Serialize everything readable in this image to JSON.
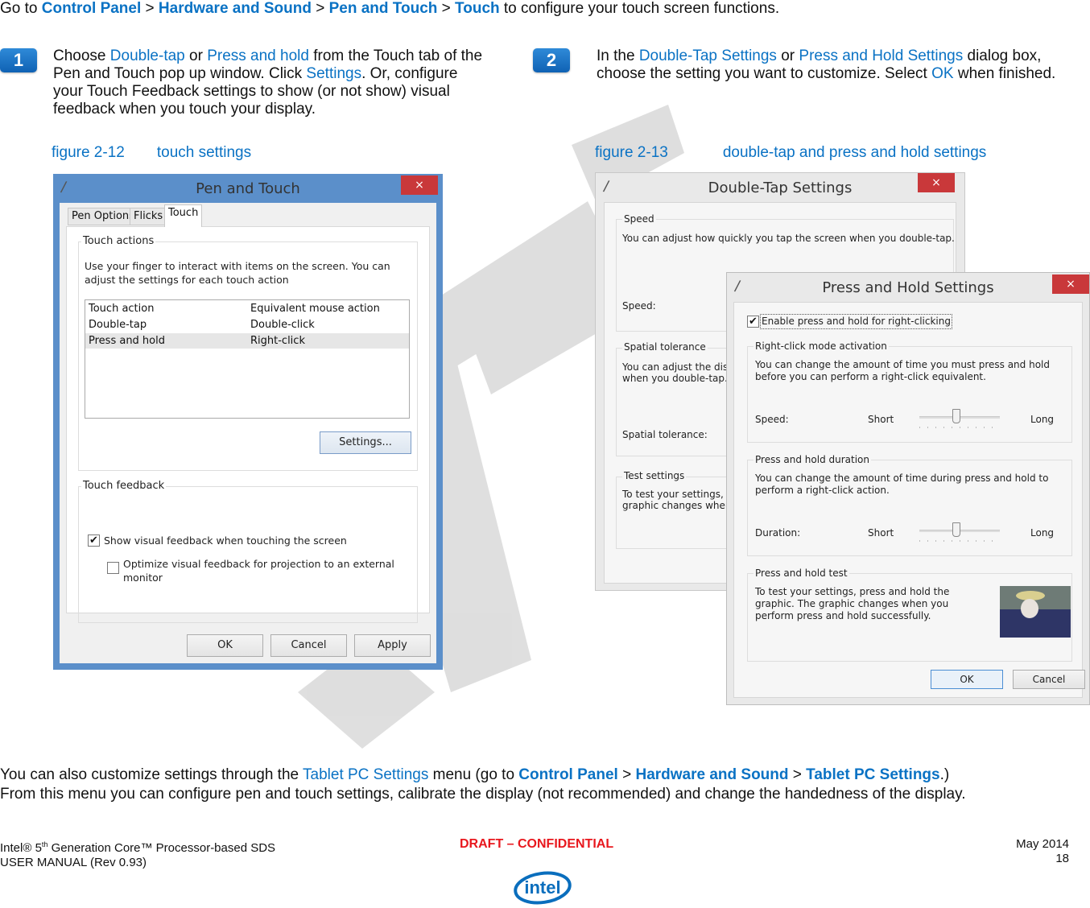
{
  "breadcrumb": {
    "prefix": "Go to ",
    "items": [
      "Control Panel",
      "Hardware and Sound",
      "Pen and Touch",
      "Touch"
    ],
    "separator": " > ",
    "suffix": " to configure your touch screen functions."
  },
  "steps": [
    {
      "number": "1",
      "text_parts": [
        {
          "t": "Choose ",
          "link": false
        },
        {
          "t": "Double-tap",
          "link": true
        },
        {
          "t": " or ",
          "link": false
        },
        {
          "t": "Press and hold",
          "link": true
        },
        {
          "t": " from the Touch tab of the Pen and Touch pop up window. Click ",
          "link": false
        },
        {
          "t": "Settings",
          "link": true
        },
        {
          "t": ". Or, configure your Touch Feedback settings to show (or not show) visual feedback when you touch your display.",
          "link": false
        }
      ],
      "figure_number": "figure 2-12",
      "figure_caption": "touch settings"
    },
    {
      "number": "2",
      "text_parts": [
        {
          "t": "In the ",
          "link": false
        },
        {
          "t": "Double-Tap Settings",
          "link": true
        },
        {
          "t": " or ",
          "link": false
        },
        {
          "t": "Press and Hold Settings",
          "link": true
        },
        {
          "t": " dialog box, choose the setting you want to customize. Select ",
          "link": false
        },
        {
          "t": "OK",
          "link": true
        },
        {
          "t": " when finished.",
          "link": false
        }
      ],
      "figure_number": "figure 2-13",
      "figure_caption": "double-tap and press and hold settings"
    }
  ],
  "pen_touch_dialog": {
    "title": "Pen and Touch",
    "close": "×",
    "tabs": [
      "Pen Options",
      "Flicks",
      "Touch"
    ],
    "active_tab": "Touch",
    "touch_actions_label": "Touch actions",
    "touch_actions_desc": "Use your finger to interact with items on the screen. You can adjust the settings for each touch action",
    "columns": [
      "Touch action",
      "Equivalent mouse action"
    ],
    "rows": [
      {
        "action": "Double-tap",
        "mouse": "Double-click",
        "selected": false
      },
      {
        "action": "Press and hold",
        "mouse": "Right-click",
        "selected": true
      }
    ],
    "settings_button": "Settings...",
    "touch_feedback_label": "Touch feedback",
    "show_feedback": {
      "label": "Show visual feedback when touching the screen",
      "checked": true
    },
    "optimize_feedback": {
      "label": "Optimize visual feedback for projection to an external monitor",
      "checked": false
    },
    "buttons": {
      "ok": "OK",
      "cancel": "Cancel",
      "apply": "Apply"
    }
  },
  "double_tap_dialog": {
    "title": "Double-Tap Settings",
    "close": "×",
    "speed_label": "Speed",
    "speed_desc": "You can adjust how quickly you tap the screen when you double-tap.",
    "speed_field": "Speed:",
    "spatial_label": "Spatial tolerance",
    "spatial_desc_1": "You can adjust the dista",
    "spatial_desc_2": "when you double-tap.",
    "spatial_field": "Spatial tolerance:",
    "test_label": "Test settings",
    "test_desc_1": "To test your settings, do",
    "test_desc_2": "graphic changes when y"
  },
  "press_hold_dialog": {
    "title": "Press and Hold Settings",
    "close": "×",
    "enable": {
      "label": "Enable press and hold for right-clicking",
      "checked": true
    },
    "activation_label": "Right-click mode activation",
    "activation_desc": "You can change the amount of time you must press and hold before you can perform a right-click equivalent.",
    "speed_field": "Speed:",
    "speed_slider": {
      "min_label": "Short",
      "max_label": "Long",
      "value_fraction": 0.45
    },
    "duration_label": "Press and hold duration",
    "duration_desc": "You can change the amount of time during press and hold to perform a right-click action.",
    "duration_field": "Duration:",
    "duration_slider": {
      "min_label": "Short",
      "max_label": "Long",
      "value_fraction": 0.45
    },
    "test_label": "Press and hold test",
    "test_desc": "To test your settings, press and hold the graphic. The graphic changes when you perform press and hold successfully.",
    "buttons": {
      "ok": "OK",
      "cancel": "Cancel"
    }
  },
  "bottom_paragraph": {
    "line1_parts": [
      {
        "t": "You can also customize settings through the ",
        "style": "plain"
      },
      {
        "t": "Tablet PC Settings",
        "style": "link"
      },
      {
        "t": " menu (go to ",
        "style": "plain"
      },
      {
        "t": "Control Panel",
        "style": "bold"
      },
      {
        "t": " > ",
        "style": "plain"
      },
      {
        "t": "Hardware and Sound",
        "style": "bold"
      },
      {
        "t": " > ",
        "style": "plain"
      },
      {
        "t": "Tablet PC Settings",
        "style": "bold"
      },
      {
        "t": ".)",
        "style": "plain"
      }
    ],
    "line2": "From this menu you can configure pen and touch settings, calibrate the display (not recommended) and change the handedness of the display."
  },
  "footer": {
    "left_line1_a": "Intel® 5",
    "left_line1_sup": "th",
    "left_line1_b": " Generation Core™ Processor-based SDS",
    "left_line2": "USER MANUAL (Rev 0.93)",
    "center": "DRAFT – CONFIDENTIAL",
    "right_line1": "May 2014",
    "right_line2": "18",
    "logo_text": "intel"
  },
  "watermark": "DRAFT",
  "colors": {
    "link": "#0a72c4",
    "draft": "#e8171d",
    "win8_frame": "#5b8fca",
    "close": "#c9383a"
  }
}
